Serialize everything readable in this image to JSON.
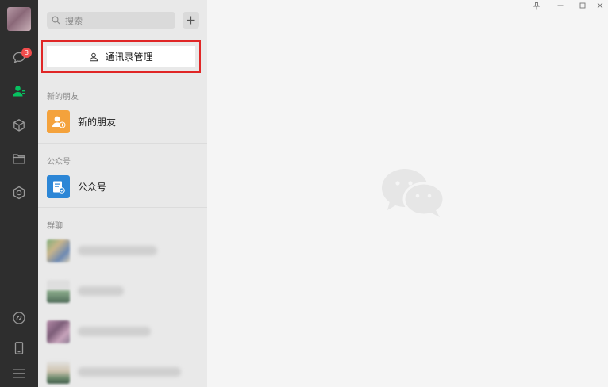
{
  "sidebar": {
    "chat_badge": "3",
    "icons": [
      "avatar",
      "chat-icon",
      "contacts-icon",
      "favorites-icon",
      "files-icon",
      "miniprogram-icon",
      "moments-icon",
      "phone-icon",
      "menu-icon"
    ],
    "active": "contacts-icon"
  },
  "search": {
    "placeholder": "搜索"
  },
  "add_button": {
    "label": "+"
  },
  "contacts_manage": {
    "label": "通讯录管理"
  },
  "sections": {
    "new_friends": {
      "title": "新的朋友",
      "item_label": "新的朋友"
    },
    "official_accounts": {
      "title": "公众号",
      "item_label": "公众号"
    },
    "group_chats": {
      "title": "群聊"
    }
  },
  "window_controls": [
    "pin-icon",
    "minimize-icon",
    "maximize-icon",
    "close-icon"
  ],
  "colors": {
    "accent": "#07c160",
    "new_friend_icon": "#f4a23c",
    "official_icon": "#2c86d6",
    "highlight_border": "#e02626"
  }
}
